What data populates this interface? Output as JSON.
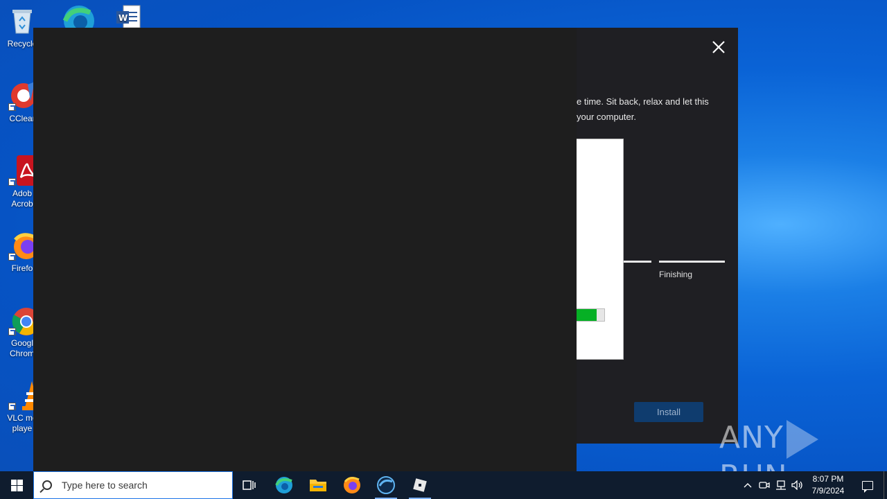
{
  "desktop": {
    "icons": [
      {
        "label": "Recycle",
        "icon": "recycle-bin-icon"
      },
      {
        "label": "CClear",
        "icon": "ccleaner-icon"
      },
      {
        "label": "Adob\nAcrob",
        "icon": "adobe-acrobat-icon"
      },
      {
        "label": "Firefo",
        "icon": "firefox-icon"
      },
      {
        "label": "Googl\nChrom",
        "icon": "chrome-icon"
      },
      {
        "label": "VLC me\nplaye",
        "icon": "vlc-icon"
      }
    ],
    "top_icons": [
      "edge-icon",
      "word-document-icon"
    ]
  },
  "installer": {
    "description_line1": "e time. Sit back, relax and let this",
    "description_line2": "your computer.",
    "step_label": "Finishing",
    "install_button": "Install",
    "progress": 0.72
  },
  "watermark": {
    "left": "ANY",
    "right": "RUN"
  },
  "taskbar": {
    "search_placeholder": "Type here to search",
    "apps": [
      "task-view-icon",
      "edge-icon",
      "file-explorer-icon",
      "firefox-icon",
      "edge-beta-icon",
      "roblox-icon"
    ],
    "time": "8:07 PM",
    "date": "7/9/2024"
  },
  "colors": {
    "accent_blue": "#0f3c6e",
    "progress_green": "#06b025",
    "desktop_blue": "#0a63d6"
  }
}
